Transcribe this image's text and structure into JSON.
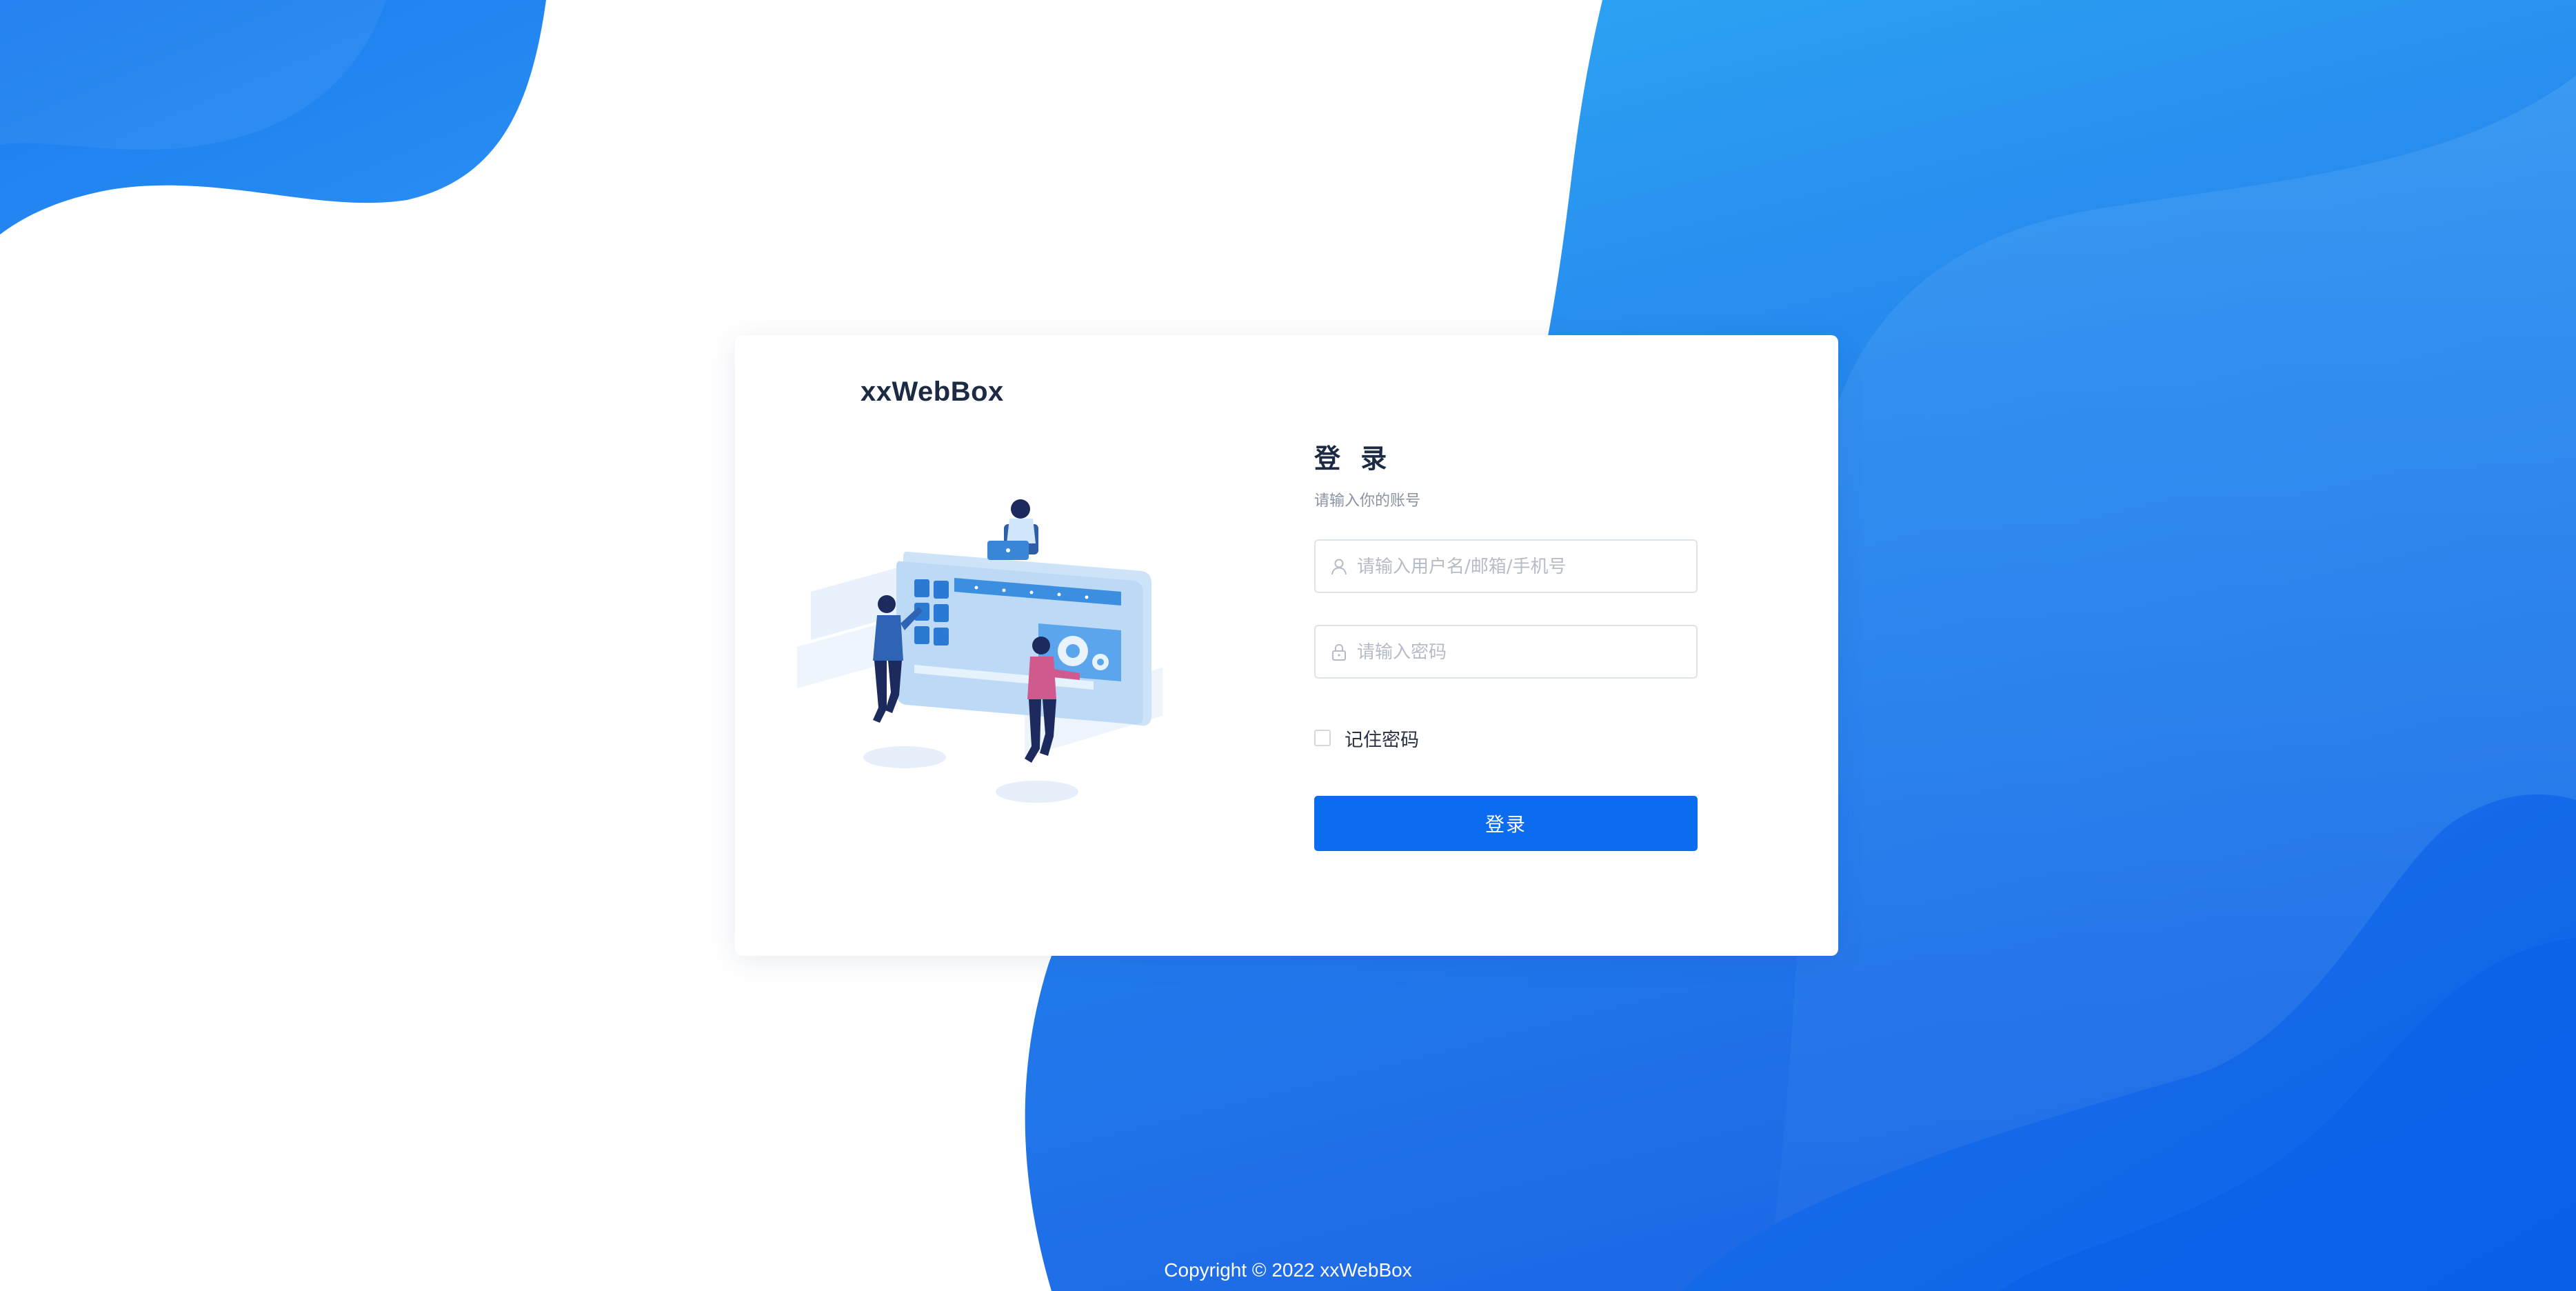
{
  "brand": {
    "name": "xxWebBox"
  },
  "login": {
    "title": "登 录",
    "subtitle": "请输入你的账号",
    "username": {
      "value": "",
      "placeholder": "请输入用户名/邮箱/手机号",
      "icon": "user-icon"
    },
    "password": {
      "value": "",
      "placeholder": "请输入密码",
      "icon": "lock-icon"
    },
    "remember": {
      "label": "记住密码",
      "checked": false
    },
    "submit_label": "登录"
  },
  "footer": {
    "copyright": "Copyright © 2022 xxWebBox"
  },
  "colors": {
    "primary": "#0b6cf0",
    "bg_blue_light": "#2fa8f2",
    "bg_blue_dark": "#1a66e8",
    "text_dark": "#1c2a44",
    "text_muted": "#8a93a3"
  }
}
